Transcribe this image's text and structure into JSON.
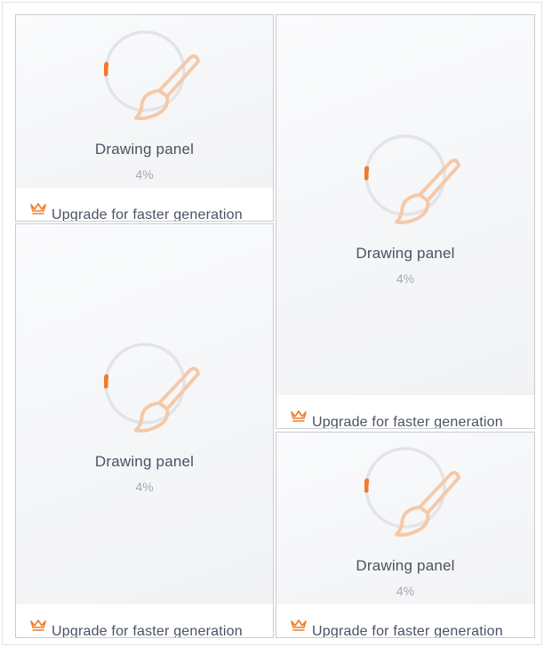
{
  "colors": {
    "accent": "#f07b2a",
    "track": "#e3e4e7",
    "brush": "#f5c9a8",
    "title": "#4a5262",
    "percent": "#a3a8b1"
  },
  "icons": {
    "progress_center": "paintbrush-icon",
    "upgrade": "crown-icon"
  },
  "cards": [
    {
      "title": "Drawing panel",
      "percent_label": "4%",
      "progress": 0.04,
      "upgrade_label": "Upgrade for faster generation"
    },
    {
      "title": "Drawing panel",
      "percent_label": "4%",
      "progress": 0.04,
      "upgrade_label": "Upgrade for faster generation"
    },
    {
      "title": "Drawing panel",
      "percent_label": "4%",
      "progress": 0.04,
      "upgrade_label": "Upgrade for faster generation"
    },
    {
      "title": "Drawing panel",
      "percent_label": "4%",
      "progress": 0.04,
      "upgrade_label": "Upgrade for faster generation"
    }
  ]
}
